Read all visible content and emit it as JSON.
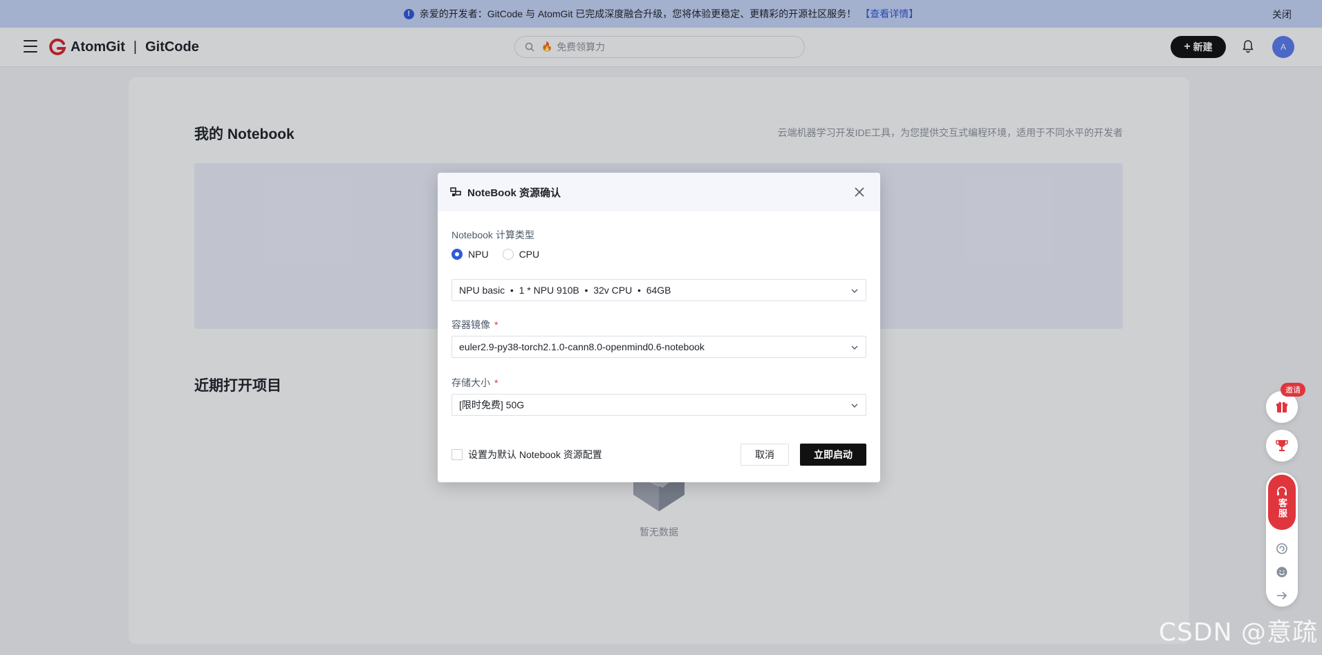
{
  "banner": {
    "info_icon": "!",
    "message": "亲爱的开发者：GitCode 与 AtomGit 已完成深度融合升级，您将体验更稳定、更精彩的开源社区服务！",
    "link": "【查看详情】",
    "close": "关闭"
  },
  "header": {
    "logo_left": "AtomGit",
    "logo_sep": "|",
    "logo_right": "GitCode",
    "search_placeholder": "免费领算力",
    "new_button": "新建",
    "new_button_icon": "+",
    "avatar": "A"
  },
  "main": {
    "title": "我的 Notebook",
    "description": "云端机器学习开发IDE工具，为您提供交互式编程环境，适用于不同水平的开发者",
    "recent_title": "近期打开项目",
    "empty_text": "暂无数据"
  },
  "modal": {
    "title": "NoteBook 资源确认",
    "compute_type_label": "Notebook 计算类型",
    "compute_options": [
      "NPU",
      "CPU"
    ],
    "compute_selected": "NPU",
    "spec_value": "NPU basic  •  1 * NPU 910B  •  32v CPU  •  64GB",
    "image_label": "容器镜像",
    "image_value": "euler2.9-py38-torch2.1.0-cann8.0-openmind0.6-notebook",
    "storage_label": "存储大小",
    "storage_value": "[限时免费] 50G",
    "required_mark": "*",
    "default_checkbox": "设置为默认 Notebook 资源配置",
    "cancel": "取消",
    "start": "立即启动"
  },
  "float_toolbar": {
    "invite_badge": "邀请",
    "service": "客服"
  },
  "watermark": "CSDN @意疏",
  "colors": {
    "accent": "#2f5bd8",
    "brand_red": "#e0353d",
    "primary_button": "#111111",
    "banner_bg": "#c9d7fb"
  }
}
